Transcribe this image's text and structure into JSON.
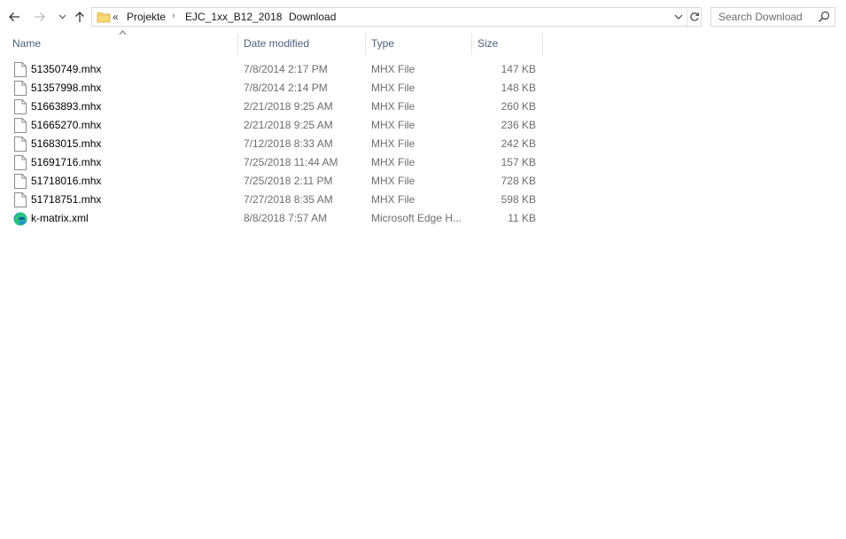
{
  "navigation": {
    "back_icon": "arrow-left-icon",
    "forward_icon": "arrow-right-icon",
    "recent_icon": "chevron-down-icon",
    "up_icon": "arrow-up-icon"
  },
  "address_bar": {
    "overflow": "«",
    "crumbs": [
      "Projekte",
      "EJC_1xx_B12_2018",
      "Download"
    ],
    "separator": "›"
  },
  "search": {
    "placeholder": "Search Download",
    "value": ""
  },
  "columns": {
    "name": "Name",
    "date": "Date modified",
    "type": "Type",
    "size": "Size"
  },
  "files": [
    {
      "name": "51350749.mhx",
      "date": "7/8/2014 2:17 PM",
      "type": "MHX File",
      "size": "147 KB",
      "icon": "document-icon"
    },
    {
      "name": "51357998.mhx",
      "date": "7/8/2014 2:14 PM",
      "type": "MHX File",
      "size": "148 KB",
      "icon": "document-icon"
    },
    {
      "name": "51663893.mhx",
      "date": "2/21/2018 9:25 AM",
      "type": "MHX File",
      "size": "260 KB",
      "icon": "document-icon"
    },
    {
      "name": "51665270.mhx",
      "date": "2/21/2018 9:25 AM",
      "type": "MHX File",
      "size": "236 KB",
      "icon": "document-icon"
    },
    {
      "name": "51683015.mhx",
      "date": "7/12/2018 8:33 AM",
      "type": "MHX File",
      "size": "242 KB",
      "icon": "document-icon"
    },
    {
      "name": "51691716.mhx",
      "date": "7/25/2018 11:44 AM",
      "type": "MHX File",
      "size": "157 KB",
      "icon": "document-icon"
    },
    {
      "name": "51718016.mhx",
      "date": "7/25/2018 2:11 PM",
      "type": "MHX File",
      "size": "728 KB",
      "icon": "document-icon"
    },
    {
      "name": "51718751.mhx",
      "date": "7/27/2018 8:35 AM",
      "type": "MHX File",
      "size": "598 KB",
      "icon": "document-icon"
    },
    {
      "name": "k-matrix.xml",
      "date": "8/8/2018 7:57 AM",
      "type": "Microsoft Edge H...",
      "size": "11 KB",
      "icon": "edge-browser-icon"
    }
  ],
  "colors": {
    "header_text": "#4c607a",
    "muted_text": "#6d6d6d",
    "folder_yellow": "#f8d775"
  }
}
